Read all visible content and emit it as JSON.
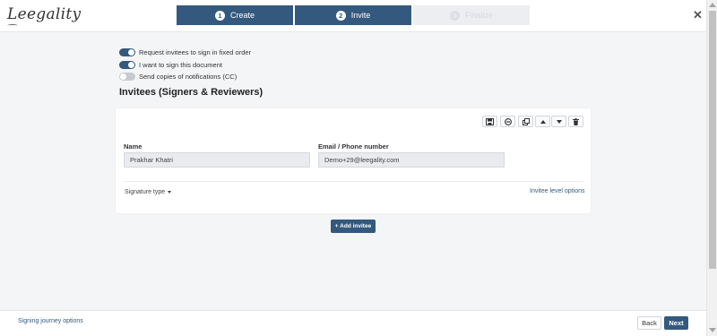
{
  "brand": {
    "logo_text": "Leegality"
  },
  "steps": [
    {
      "number": "1",
      "label": "Create",
      "state": "done"
    },
    {
      "number": "2",
      "label": "Invite",
      "state": "active"
    },
    {
      "number": "3",
      "label": "Finalize",
      "state": "disabled"
    }
  ],
  "toggles": [
    {
      "label": "Request invitees to sign in fixed order",
      "on": true
    },
    {
      "label": "I want to sign this document",
      "on": true
    },
    {
      "label": "Send copies of notifications (CC)",
      "on": false
    }
  ],
  "section_title": "Invitees (Signers & Reviewers)",
  "invitee_toolbar": [
    "save-template-icon",
    "remove-circle-icon",
    "copy-icon",
    "move-up-icon",
    "move-down-icon",
    "trash-icon"
  ],
  "invitee": {
    "name_label": "Name",
    "name_value": "Prakhar Khatri",
    "email_label": "Email / Phone number",
    "email_value": "Demo+29@leegality.com",
    "signature_type_label": "Signature type",
    "invitee_options_label": "Invitee level options"
  },
  "add_invitee_label": "+ Add invitee",
  "footer": {
    "journey_label": "Signing journey options",
    "back_label": "Back",
    "next_label": "Next"
  },
  "colors": {
    "primary": "#34597e",
    "background": "#f4f5f7"
  }
}
